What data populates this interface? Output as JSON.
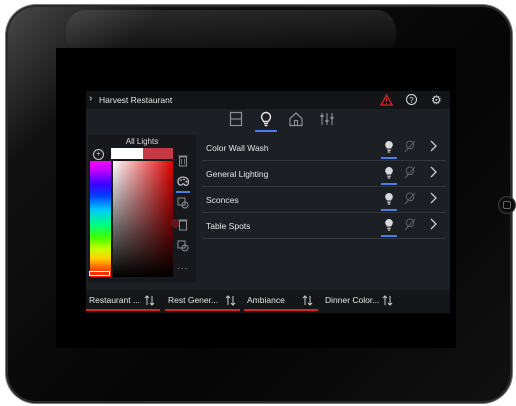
{
  "header": {
    "title": "Harvest Restaurant",
    "icons": [
      "chevron-right-icon",
      "warning-icon",
      "help-icon",
      "gear-icon"
    ],
    "help_glyph": "?",
    "gear_glyph": "⚙",
    "warning_color": "#e0202a"
  },
  "tabs": [
    {
      "icon": "shade-icon",
      "active": false
    },
    {
      "icon": "light-bulb-icon",
      "active": true
    },
    {
      "icon": "home-icon",
      "active": false
    },
    {
      "icon": "sliders-icon",
      "active": false
    }
  ],
  "color_panel": {
    "group_label": "All Lights",
    "add_glyph": "+",
    "selected_color": "#c83a43",
    "more_glyph": "..."
  },
  "lights": [
    {
      "name": "Color Wall Wash"
    },
    {
      "name": "General Lighting"
    },
    {
      "name": "Sconces"
    },
    {
      "name": "Table Spots"
    }
  ],
  "scenes": [
    {
      "label": "Restaurant ...",
      "active": true
    },
    {
      "label": "Rest Gener...",
      "active": true
    },
    {
      "label": "Ambiance",
      "active": true
    },
    {
      "label": "Dinner Color...",
      "active": false
    }
  ],
  "colors": {
    "accent_blue": "#4a7ee6",
    "active_red": "#d8232a",
    "app_background": "#1c1f24"
  }
}
